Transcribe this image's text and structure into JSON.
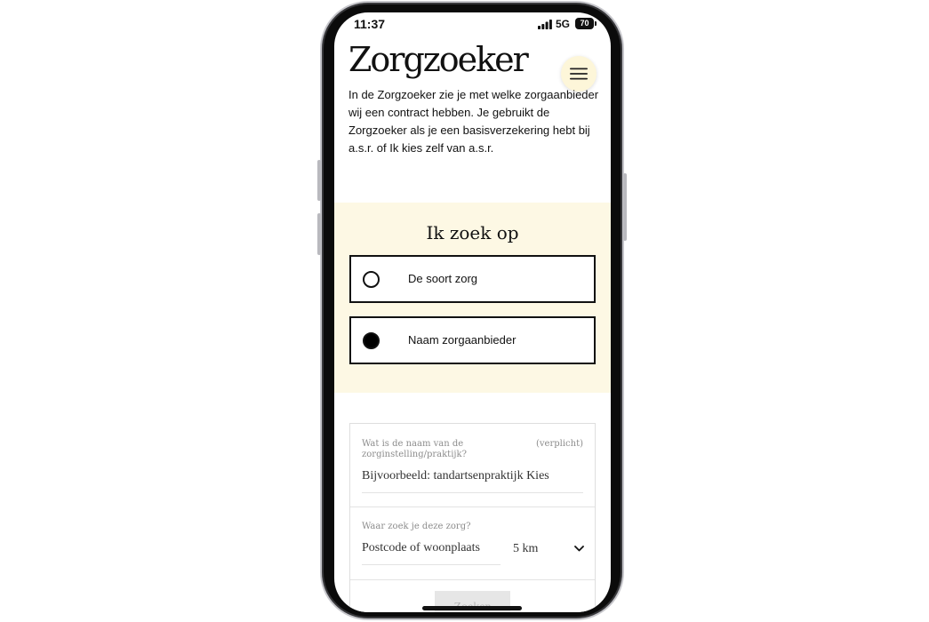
{
  "status_bar": {
    "time": "11:37",
    "network": "5G",
    "battery": "70",
    "signal_icon": "signal-icon",
    "battery_icon": "battery-icon"
  },
  "header": {
    "title": "Zorgzoeker",
    "menu_icon": "hamburger-menu-icon"
  },
  "intro": {
    "text": "In de Zorgzoeker zie je met welke zorgaanbieder wij een contract hebben. Je gebruikt de Zorgzoeker als je een basisverzekering hebt bij a.s.r. of Ik kies zelf van a.s.r."
  },
  "search_type": {
    "heading": "Ik zoek op",
    "options": [
      {
        "label": "De soort zorg",
        "selected": false
      },
      {
        "label": "Naam zorgaanbieder",
        "selected": true
      }
    ]
  },
  "form": {
    "name_field": {
      "label": "Wat is de naam van de zorginstelling/praktijk?",
      "required_label": "(verplicht)",
      "placeholder": "Bijvoorbeeld: tandartsenpraktijk Kies",
      "value": ""
    },
    "location_field": {
      "label": "Waar zoek je deze zorg?",
      "placeholder": "Postcode of woonplaats",
      "value": "",
      "radius": "5 km",
      "radius_icon": "chevron-down-icon"
    },
    "submit_label": "Zoeken"
  },
  "colors": {
    "search_panel_background": "#fdf8e4",
    "menu_button_background": "#fdf6d9",
    "text": "#111111",
    "field_label": "#8c8c8c",
    "button_disabled_background": "#e6e6e6",
    "button_disabled_text": "#b5b5b5"
  }
}
